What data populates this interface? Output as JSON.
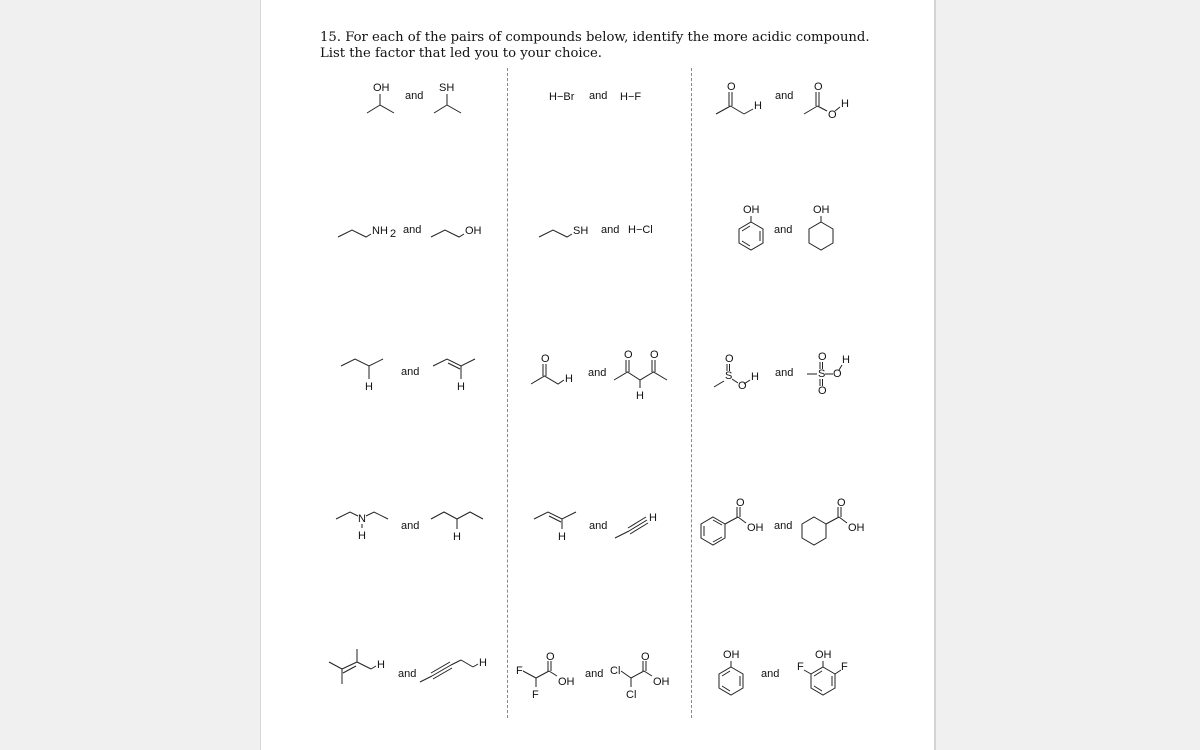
{
  "question": {
    "number": "15.",
    "text": "For each of the pairs of compounds below, identify the more acidic compound. List the factor that led you to your choice."
  },
  "connector": "and",
  "labels": {
    "OH": "OH",
    "SH": "SH",
    "NH2": "NH",
    "sub2": "2",
    "H": "H",
    "O": "O",
    "S": "S",
    "N": "N",
    "F": "F",
    "Cl": "Cl",
    "HBr": "H−Br",
    "HF": "H−F",
    "HCl": "H−Cl"
  },
  "pairs": [
    {
      "row": 1,
      "col": 1,
      "left": "isopropanol",
      "right": "2-propanethiol"
    },
    {
      "row": 1,
      "col": 2,
      "left": "H-Br",
      "right": "H-F"
    },
    {
      "row": 1,
      "col": 3,
      "left": "acetone (alpha C-H)",
      "right": "acetic acid (O-H)"
    },
    {
      "row": 2,
      "col": 1,
      "left": "propylamine",
      "right": "propanol"
    },
    {
      "row": 2,
      "col": 2,
      "left": "propanethiol",
      "right": "H-Cl"
    },
    {
      "row": 2,
      "col": 3,
      "left": "phenol",
      "right": "cyclohexanol"
    },
    {
      "row": 3,
      "col": 1,
      "left": "butane (C-H)",
      "right": "2-butene (vinyl C-H)"
    },
    {
      "row": 3,
      "col": 2,
      "left": "acetone (alpha C-H)",
      "right": "2,4-pentanedione (central C-H)"
    },
    {
      "row": 3,
      "col": 3,
      "left": "methanesulfinic acid",
      "right": "methanesulfonic acid"
    },
    {
      "row": 4,
      "col": 1,
      "left": "diethylamine (N-H)",
      "right": "pentane (C-H)"
    },
    {
      "row": 4,
      "col": 2,
      "left": "2-butene (vinyl C-H)",
      "right": "propyne (terminal C-H)"
    },
    {
      "row": 4,
      "col": 3,
      "left": "benzoic acid",
      "right": "cyclohexanecarboxylic acid"
    },
    {
      "row": 5,
      "col": 1,
      "left": "2,3-dimethyl-2-butene (allylic C-H)",
      "right": "2-pentyne (propargylic C-H)"
    },
    {
      "row": 5,
      "col": 2,
      "left": "difluoroacetic acid",
      "right": "dichloroacetic acid"
    },
    {
      "row": 5,
      "col": 3,
      "left": "phenol",
      "right": "2,6-difluorophenol"
    }
  ]
}
